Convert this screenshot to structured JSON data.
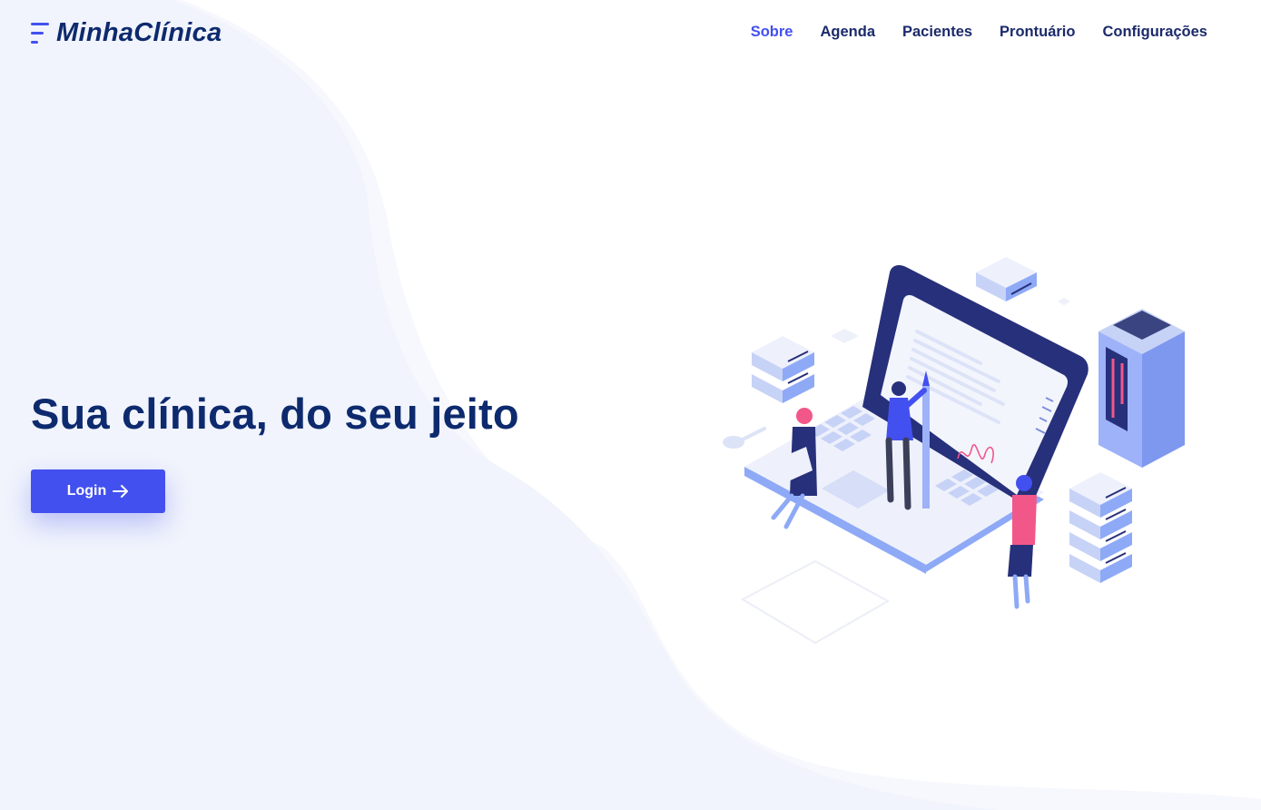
{
  "brand": {
    "name": "MinhaClínica",
    "icon": "menu-lines-icon"
  },
  "nav": {
    "items": [
      {
        "label": "Sobre",
        "active": true
      },
      {
        "label": "Agenda",
        "active": false
      },
      {
        "label": "Pacientes",
        "active": false
      },
      {
        "label": "Prontuário",
        "active": false
      },
      {
        "label": "Configurações",
        "active": false
      }
    ]
  },
  "hero": {
    "title": "Sua clínica, do seu jeito",
    "login_label": "Login",
    "login_icon": "arrow-right-icon"
  },
  "colors": {
    "accent": "#4350f0",
    "heading": "#0e2a6e",
    "nav_text": "#1b2a6b",
    "background_wave": "#f1f4fc"
  }
}
